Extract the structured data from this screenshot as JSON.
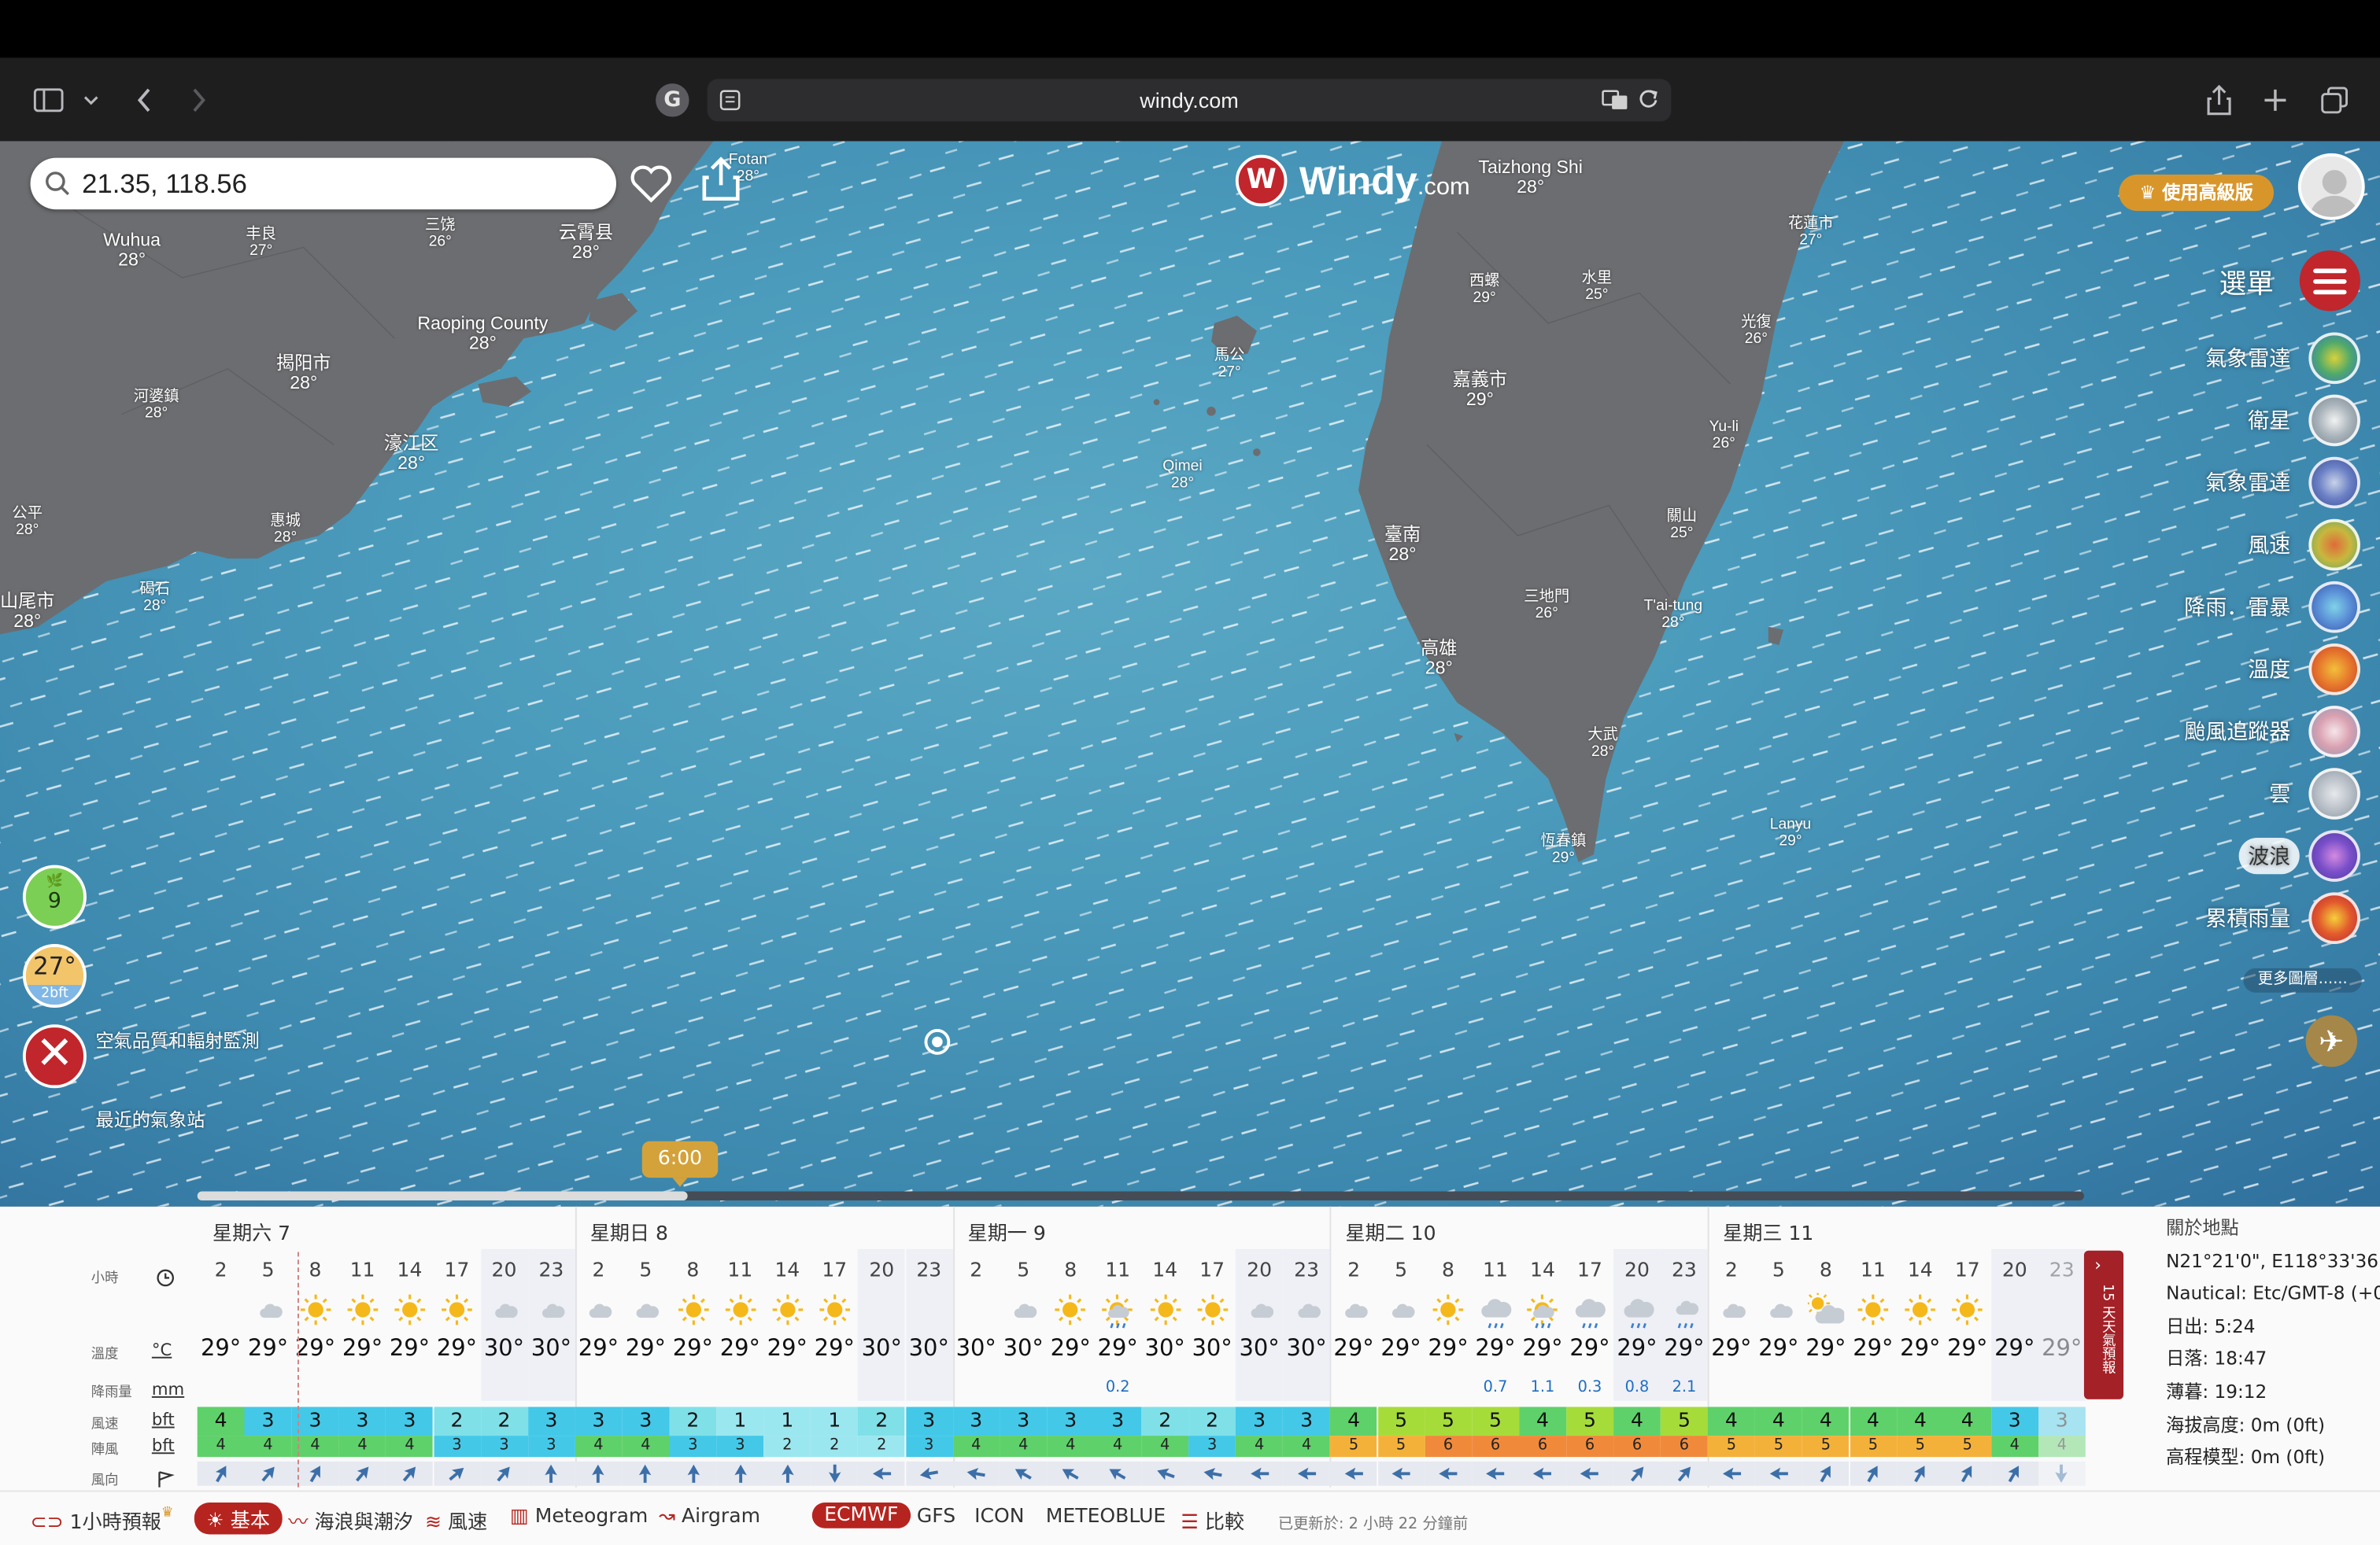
{
  "browser": {
    "url": "windy.com"
  },
  "map": {
    "search_value": "21.35, 118.56",
    "logo_text": "Windy",
    "logo_suffix": ".com",
    "premium_label": "♛ 使用高級版",
    "menu_label": "選單",
    "cities": [
      {
        "name": "Wuhua",
        "temp": "28°"
      },
      {
        "name": "丰良",
        "temp": "27°"
      },
      {
        "name": "三饶",
        "temp": "26°"
      },
      {
        "name": "云霄县",
        "temp": "28°"
      },
      {
        "name": "Fotan",
        "temp": "28°"
      },
      {
        "name": "Raoping County",
        "temp": "28°"
      },
      {
        "name": "揭阳市",
        "temp": "28°"
      },
      {
        "name": "河婆鎮",
        "temp": "28°"
      },
      {
        "name": "濠江区",
        "temp": "28°"
      },
      {
        "name": "公平",
        "temp": "28°"
      },
      {
        "name": "惠城",
        "temp": "28°"
      },
      {
        "name": "山尾市",
        "temp": "28°"
      },
      {
        "name": "碣石",
        "temp": "28°"
      },
      {
        "name": "馬公",
        "temp": "27°"
      },
      {
        "name": "Qimei",
        "temp": "28°"
      },
      {
        "name": "Taizhong Shi",
        "temp": "28°"
      },
      {
        "name": "西螺",
        "temp": "29°"
      },
      {
        "name": "水里",
        "temp": "25°"
      },
      {
        "name": "花蓮市",
        "temp": "27°"
      },
      {
        "name": "光復",
        "temp": "26°"
      },
      {
        "name": "嘉義市",
        "temp": "29°"
      },
      {
        "name": "Yu-li",
        "temp": "26°"
      },
      {
        "name": "關山",
        "temp": "25°"
      },
      {
        "name": "臺南",
        "temp": "28°"
      },
      {
        "name": "三地門",
        "temp": "26°"
      },
      {
        "name": "T'ai-tung",
        "temp": "28°"
      },
      {
        "name": "高雄",
        "temp": "28°"
      },
      {
        "name": "大武",
        "temp": "28°"
      },
      {
        "name": "恆春鎮",
        "temp": "29°"
      },
      {
        "name": "Lanyu",
        "temp": "29°"
      }
    ],
    "layers": [
      {
        "label": "氣象雷達",
        "color": "#7bbf3f"
      },
      {
        "label": "衛星",
        "color": "#c8cfd6"
      },
      {
        "label": "氣象雷達",
        "color": "#6a7fc4"
      },
      {
        "label": "風速",
        "color": "#c8b73e"
      },
      {
        "label": "降雨．雷暴",
        "color": "#5a8ed6"
      },
      {
        "label": "溫度",
        "color": "#e6782c"
      },
      {
        "label": "颱風追蹤器",
        "color": "#d9a0b0"
      },
      {
        "label": "雲",
        "color": "#b9c0c8"
      },
      {
        "label": "波浪",
        "color": "#7a4fc9"
      },
      {
        "label": "累積雨量",
        "color": "#e25a2c"
      }
    ],
    "more_layers": "更多圖層......",
    "air_quality": {
      "value": "9",
      "label": "空氣品質和輻射監測"
    },
    "station": {
      "value": "27°",
      "sub": "2bft",
      "label": "最近的氣象站"
    },
    "time_bubble": "6:00",
    "timeline_progress": 0.26
  },
  "forecast": {
    "days": [
      {
        "label": "星期六 7"
      },
      {
        "label": "星期日 8"
      },
      {
        "label": "星期一 9"
      },
      {
        "label": "星期二 10"
      },
      {
        "label": "星期三 11"
      }
    ],
    "row_labels": {
      "hour": "小時",
      "temp": "溫度",
      "temp_unit": "°C",
      "rain": "降雨量",
      "rain_unit": "mm",
      "wind": "風速",
      "wind_unit": "bft",
      "gust": "陣風",
      "gust_unit": "bft",
      "dir": "風向"
    },
    "hours": [
      "2",
      "5",
      "8",
      "11",
      "14",
      "17",
      "20",
      "23",
      "2",
      "5",
      "8",
      "11",
      "14",
      "17",
      "20",
      "23",
      "2",
      "5",
      "8",
      "11",
      "14",
      "17",
      "20",
      "23",
      "2",
      "5",
      "8",
      "11",
      "14",
      "17",
      "20",
      "23",
      "2",
      "5",
      "8",
      "11",
      "14",
      "17",
      "20",
      "23"
    ],
    "temps": [
      "29°",
      "29°",
      "29°",
      "29°",
      "29°",
      "29°",
      "30°",
      "30°",
      "29°",
      "29°",
      "29°",
      "29°",
      "29°",
      "29°",
      "30°",
      "30°",
      "30°",
      "30°",
      "29°",
      "29°",
      "30°",
      "30°",
      "30°",
      "30°",
      "29°",
      "29°",
      "29°",
      "29°",
      "29°",
      "29°",
      "29°",
      "29°",
      "29°",
      "29°",
      "29°",
      "29°",
      "29°",
      "29°",
      "29°",
      "29°"
    ],
    "rain": [
      "",
      "",
      "",
      "",
      "",
      "",
      "",
      "",
      "",
      "",
      "",
      "",
      "",
      "",
      "",
      "",
      "",
      "",
      "",
      "0.2",
      "",
      "",
      "",
      "",
      "",
      "",
      "",
      "0.7",
      "1.1",
      "0.3",
      "0.8",
      "2.1",
      "",
      "",
      "",
      "",
      "",
      "",
      "",
      ""
    ],
    "wind": [
      "4",
      "3",
      "3",
      "3",
      "3",
      "2",
      "2",
      "3",
      "3",
      "3",
      "2",
      "1",
      "1",
      "1",
      "2",
      "3",
      "3",
      "3",
      "3",
      "3",
      "2",
      "2",
      "3",
      "3",
      "4",
      "5",
      "5",
      "5",
      "4",
      "5",
      "4",
      "5",
      "4",
      "4",
      "4",
      "4",
      "4",
      "4",
      "3",
      "3"
    ],
    "gust": [
      "4",
      "4",
      "4",
      "4",
      "4",
      "3",
      "3",
      "3",
      "4",
      "4",
      "3",
      "3",
      "2",
      "2",
      "2",
      "3",
      "4",
      "4",
      "4",
      "4",
      "4",
      "3",
      "4",
      "4",
      "5",
      "5",
      "6",
      "6",
      "6",
      "6",
      "6",
      "6",
      "5",
      "5",
      "5",
      "5",
      "5",
      "5",
      "4",
      "4"
    ],
    "icons": [
      "moon",
      "moon-cloud",
      "sun",
      "sun",
      "sun",
      "sun",
      "moon-cloud",
      "moon-cloud",
      "moon-cloud",
      "moon-cloud",
      "sun",
      "sun",
      "sun",
      "sun",
      "moon",
      "moon",
      "moon",
      "moon-cloud",
      "sun",
      "sun-rain",
      "sun",
      "sun",
      "moon-cloud",
      "moon-cloud",
      "moon-cloud",
      "moon-cloud",
      "sun",
      "cloud-rain",
      "sun-rain",
      "cloud-rain",
      "cloud-rain",
      "moon-rain",
      "moon-cloud",
      "moon-cloud",
      "cloud-sun",
      "sun",
      "sun",
      "sun",
      "moon",
      "moon"
    ],
    "wind_dir_deg": [
      30,
      40,
      30,
      40,
      40,
      50,
      40,
      0,
      0,
      0,
      0,
      0,
      0,
      180,
      270,
      260,
      280,
      300,
      300,
      300,
      290,
      280,
      270,
      270,
      270,
      270,
      270,
      270,
      270,
      270,
      40,
      40,
      270,
      270,
      30,
      30,
      30,
      30,
      30,
      180
    ],
    "location": {
      "title": "關於地點",
      "coords": "N21°21'0\", E118°33'36\"",
      "tz": "Nautical: Etc/GMT-8 (+0",
      "sunrise": "日出: 5:24",
      "sunset": "日落: 18:47",
      "dusk": "薄暮: 19:12",
      "elevation": "海拔高度: 0m (0ft)",
      "model_elevation": "高程模型: 0m (0ft)"
    },
    "fifteen_days": "15 天天氣預報"
  },
  "bottom_bar": {
    "hourly": "1小時預報",
    "basic": "基本",
    "waves": "海浪與潮汐",
    "wind": "風速",
    "meteogram": "Meteogram",
    "airgram": "Airgram",
    "model_selected": "ECMWF",
    "gfs": "GFS",
    "icon": "ICON",
    "meteoblue": "METEOBLUE",
    "compare": "比較",
    "updated": "已更新於: 2 小時 22 分鐘前"
  }
}
